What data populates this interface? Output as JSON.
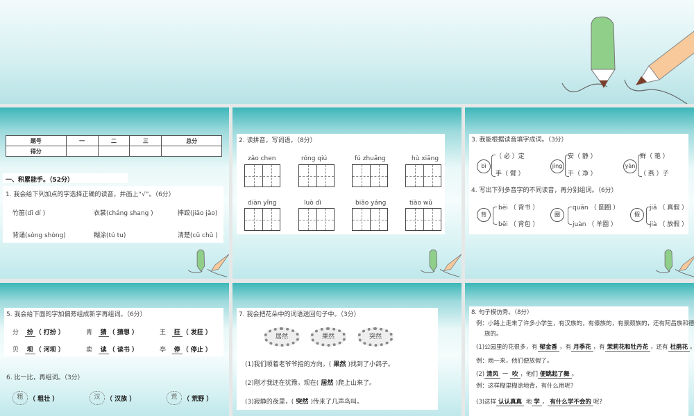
{
  "slide1": {
    "table": {
      "headers": [
        "题号",
        "一",
        "二",
        "三",
        "总分"
      ],
      "row_label": "得分"
    },
    "section": "一、积累能手。（52分）",
    "q1": "1. 我会给下列加点的字选择正确的读音，并画上“√”。（6分）",
    "items": [
      "竹笛(dī  dí )",
      "衣裳(cháng  shang )",
      "摔跤(jiāo  jǎo)",
      "背诵(sòng   shòng)",
      "糊涂(tú     tu)",
      "清楚(cǔ  chǔ )"
    ]
  },
  "slide2": {
    "q2": "2. 读拼音，写词语。（8分）",
    "pinyin": [
      "zǎo  chen",
      "róng  qiú",
      "fú  zhuāng",
      "hù  xiāng",
      "diàn  yǐng",
      "luò    dì",
      "biǎo  yáng",
      "tiào   wǔ"
    ]
  },
  "slide3": {
    "q3": "3. 我能根据读音填字成词。（3分）",
    "groups3": [
      {
        "py": "bì",
        "a": "（ 必 ）定",
        "b": "手（ 臂 ）"
      },
      {
        "py": "jìng",
        "a": "安（ 静 ）",
        "b": "干（ 净 ）"
      },
      {
        "py": "yàn",
        "a": "鲜（ 艳 ）",
        "b": "（ 燕 ）子"
      }
    ],
    "q4": "4. 写出下列多音字的不同读音，再分别组词。（6分）",
    "groups4": [
      {
        "ch": "背",
        "a": "bèi （ 背书 ）",
        "b": "bēi （ 背包 ）"
      },
      {
        "ch": "圈",
        "a": "quān （ 圆圈 ）",
        "b": "juàn （ 羊圈 ）"
      },
      {
        "ch": "假",
        "a": "jiǎ （ 真假 ）",
        "b": "jià （ 放假 ）"
      }
    ]
  },
  "slide4": {
    "q5": "5. 我会给下面的字加偏旁组成新字再组词。（6分）",
    "rows": [
      {
        "base": "分",
        "ans": "扮",
        "word": "（ 打扮 ）"
      },
      {
        "base": "青",
        "ans": "猜",
        "word": "（ 猜想 ）"
      },
      {
        "base": "王",
        "ans": "狂",
        "word": "（ 发狂 ）"
      },
      {
        "base": "贝",
        "ans": "坝",
        "word": "（ 河坝 ）"
      },
      {
        "base": "卖",
        "ans": "读",
        "word": "（ 读书 ）"
      },
      {
        "base": "亭",
        "ans": "停",
        "word": "（ 停止 ）"
      }
    ],
    "q6": "6. 比一比，再组词。（3分）",
    "flowers": [
      {
        "ch": "粗",
        "word": "（ 粗壮 ）"
      },
      {
        "ch": "汉",
        "word": "（ 汉族 ）"
      },
      {
        "ch": "荒",
        "word": "（ 荒野 ）"
      }
    ]
  },
  "slide5": {
    "q7": "7. 我会把花朵中的词语送回句子中。（3分）",
    "words": [
      "居然",
      "果然",
      "突然"
    ],
    "sentences": [
      {
        "pre": "(1)我们顺着老爷爷指的方向，(",
        "ans": " 果然 ",
        "post": ")找到了小鸽子。"
      },
      {
        "pre": "(2)刚才我还在犹豫，现在(",
        "ans": " 居然 ",
        "post": ")爬上山来了。"
      },
      {
        "pre": "(3)寂静的夜里，(",
        "ans": " 突然 ",
        "post": ")传来了几声鸟叫。"
      }
    ]
  },
  "slide6": {
    "q8": "8. 句子模仿秀。（8分）",
    "ex1a": "例：小路上走来了许多小学生，有汉族的，有傣族的，有景颇族的，还有阿昌族和德昂",
    "ex1b": "族的。",
    "s1": {
      "p1": "(1)公园里的花很多，有",
      "a1": "郁金香",
      "p2": "，有",
      "a2": "月季花",
      "p3": "，有",
      "a3": "茉莉花和牡丹花",
      "p4": "，还有",
      "a4": "杜鹃花",
      "p5": "。"
    },
    "ex2": "例：雨一来，他们便放假了。",
    "s2": {
      "p1": "(2)",
      "a1": "清风",
      "p2": "一",
      "a2": "吹",
      "p3": "，他们",
      "a3": "便跳起了舞",
      "p4": "。"
    },
    "ex3": "例：这样糊里糊涂地背，有什么用呢?",
    "s3": {
      "p1": "(3)这样",
      "a1": "认认真真",
      "p2": "地",
      "a2": "学",
      "p3": "，",
      "a3": "有什么学不会的",
      "p4": "呢?"
    }
  },
  "colors": {
    "teal": "#3cb6b8",
    "pencil_green": "#8fcf8a",
    "pencil_orange": "#f8c99a"
  }
}
